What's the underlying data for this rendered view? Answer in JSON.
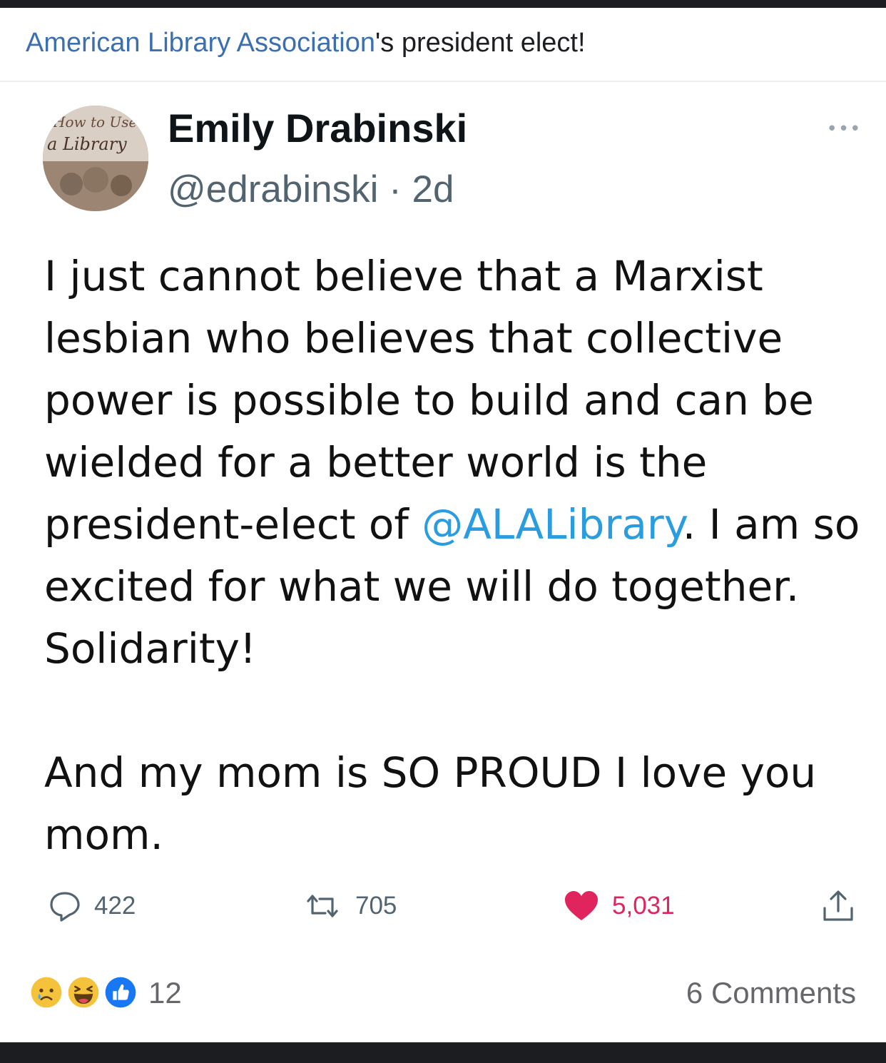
{
  "facebook_post": {
    "caption_page_link": "American Library Association",
    "caption_rest": "'s president elect!",
    "reactions": {
      "types": [
        "sad",
        "haha",
        "like"
      ],
      "count": "12"
    },
    "comments_label": "6 Comments"
  },
  "tweet": {
    "avatar_text_line1": "How to Use",
    "avatar_text_line2": "a Library",
    "display_name": "Emily Drabinski",
    "handle": "@edrabinski",
    "separator": " · ",
    "time_ago": "2d",
    "more_icon": "more-horizontal-icon",
    "body_para1_before_mention": "I just cannot believe that a Marxist lesbian who believes that collective power is possible to build and can be wielded for a better world is the president-elect of ",
    "body_mention": "@ALALibrary",
    "body_para1_after_mention": ". I am so excited for what we will do together. Solidarity!",
    "body_para2": "And my mom is SO PROUD I love you mom.",
    "actions": {
      "replies": "422",
      "retweets": "705",
      "likes": "5,031"
    },
    "colors": {
      "mention": "#2a9de0",
      "like": "#e0245e",
      "muted": "#536471"
    }
  }
}
